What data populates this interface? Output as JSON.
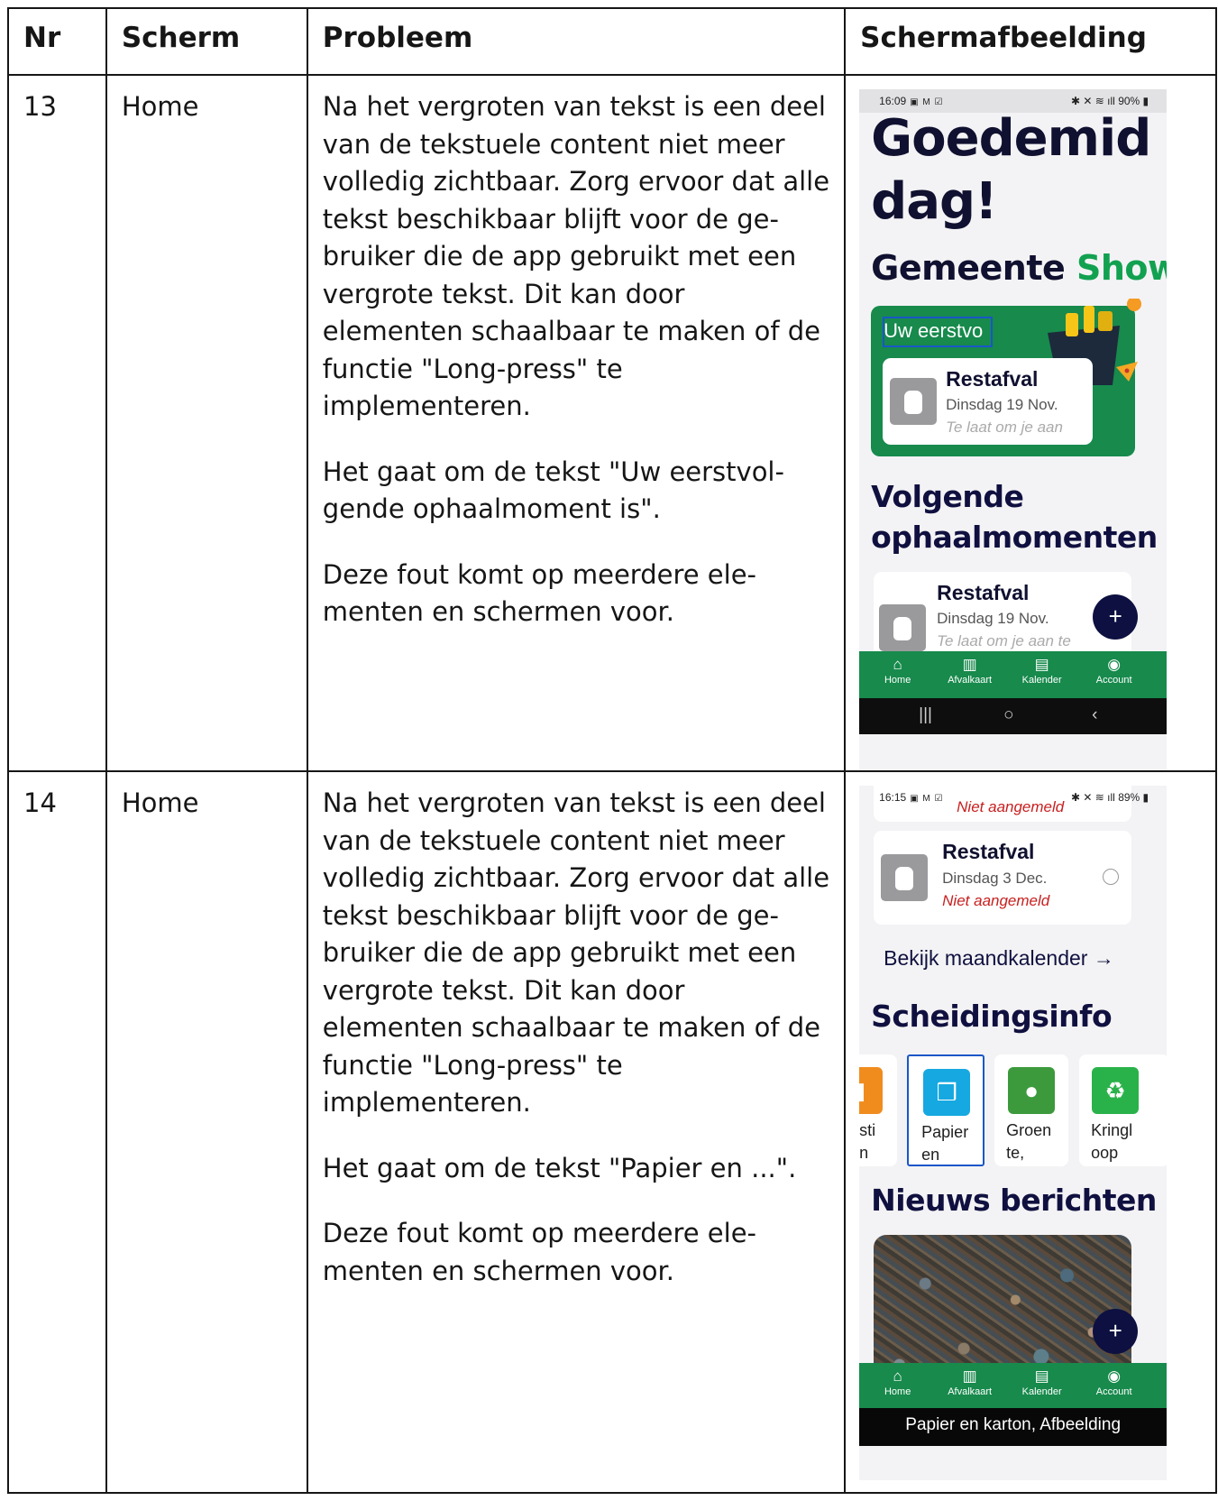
{
  "table": {
    "headers": {
      "nr": "Nr",
      "screen": "Scherm",
      "problem": "Probleem",
      "screenshot": "Schermafbeelding"
    },
    "rows": [
      {
        "nr": "13",
        "screen": "Home",
        "problem": [
          "Na het vergroten van tekst is een deel van de tekstuele content niet meer volledig zichtbaar. Zorg ervoor dat alle tekst beschikbaar blijft voor de ge-bruiker die de app gebruikt met een vergrote tekst. Dit kan door elementen schaalbaar te maken of de functie \"Long-press\" te implementeren.",
          "Het gaat om de tekst \"Uw eerstvol-gende ophaalmoment is\".",
          "Deze fout komt op meerdere ele-menten en schermen voor."
        ],
        "screenshot": {
          "status_time": "16:09",
          "status_right": "90%",
          "greeting_line1": "Goedemid",
          "greeting_line2": "dag!",
          "municipality_prefix": "Gemeente ",
          "municipality_name": "Showc",
          "next_label": "Uw eerstvo",
          "card": {
            "title": "Restafval",
            "date": "Dinsdag 19 Nov.",
            "note": "Te laat om je aan"
          },
          "section_line1": "Volgende",
          "section_line2": "ophaalmomenten",
          "card2": {
            "title": "Restafval",
            "date": "Dinsdag 19 Nov.",
            "note": "Te laat om je aan te"
          },
          "fab": "+",
          "nav": [
            "Home",
            "Afvalkaart",
            "Kalender",
            "Account"
          ],
          "nav_icons": [
            "home-icon",
            "map-icon",
            "calendar-icon",
            "account-icon"
          ],
          "sys": [
            "|||",
            "○",
            "‹"
          ]
        }
      },
      {
        "nr": "14",
        "screen": "Home",
        "problem": [
          "Na het vergroten van tekst is een deel van de tekstuele content niet meer volledig zichtbaar. Zorg ervoor dat alle tekst beschikbaar blijft voor de ge-bruiker die de app gebruikt met een vergrote tekst. Dit kan door elementen schaalbaar te maken of de functie \"Long-press\" te implementeren.",
          "Het gaat om de tekst \"Papier en ...\".",
          "Deze fout komt op meerdere ele-menten en schermen voor."
        ],
        "screenshot": {
          "status_time": "16:15",
          "status_right": "89%",
          "top_note": "Niet aangemeld",
          "card": {
            "title": "Restafval",
            "date": "Dinsdag 3 Dec.",
            "note": "Niet aangemeld"
          },
          "calendar_link": "Bekijk maandkalender →",
          "section": "Scheidingsinfo",
          "tiles": [
            {
              "line1": "sti",
              "line2": "n"
            },
            {
              "line1": "Papier",
              "line2": "en"
            },
            {
              "line1": "Groen",
              "line2": "te,"
            },
            {
              "line1": "Kringl",
              "line2": "oop"
            }
          ],
          "news": "Nieuws berichten",
          "fab": "+",
          "nav": [
            "Home",
            "Afvalkaart",
            "Kalender",
            "Account"
          ],
          "caption": "Papier en karton, Afbeelding"
        }
      }
    ]
  },
  "colors": {
    "green": "#178a4c",
    "navy": "#0d1040",
    "focus": "#1a56c8",
    "red": "#c81f1f"
  }
}
